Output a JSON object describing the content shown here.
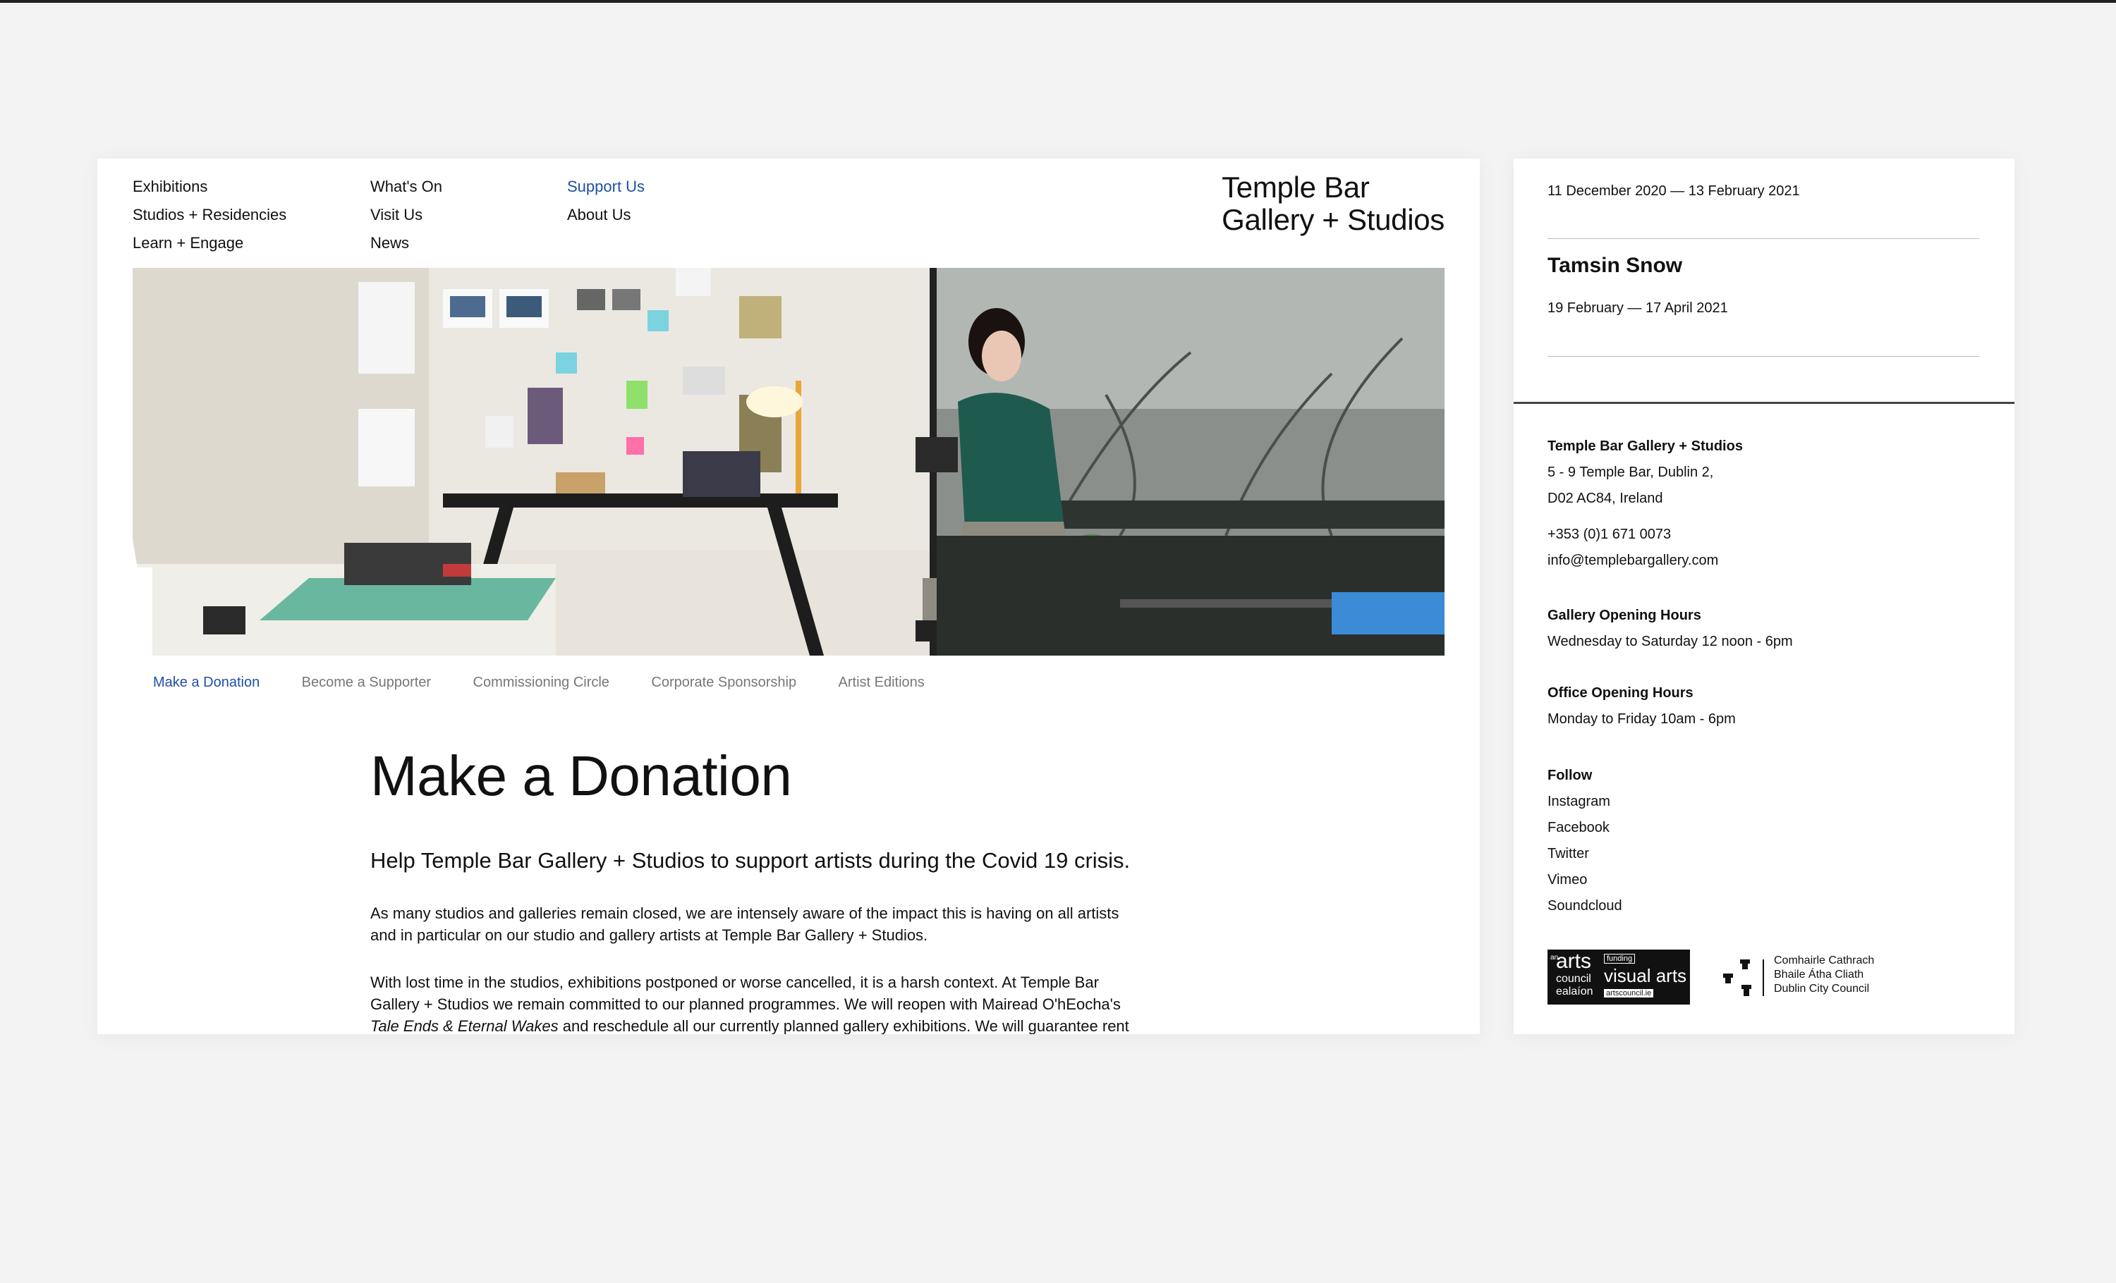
{
  "nav": {
    "col1": [
      "Exhibitions",
      "Studios + Residencies",
      "Learn + Engage"
    ],
    "col2": [
      "What's On",
      "Visit Us",
      "News"
    ],
    "col3_active": "Support Us",
    "col3": [
      "About Us"
    ]
  },
  "logo": {
    "line1": "Temple Bar",
    "line2": "Gallery + Studios"
  },
  "hero_image": {
    "alt": "Artist in studio holding a camera"
  },
  "subnav": [
    "Make a Donation",
    "Become a Supporter",
    "Commissioning Circle",
    "Corporate Sponsorship",
    "Artist Editions"
  ],
  "content": {
    "title": "Make a Donation",
    "lead": "Help Temple Bar Gallery + Studios to support artists during the Covid 19 crisis.",
    "p1": "As many studios and galleries remain closed, we are intensely aware of the impact this is having on all artists and in particular on our studio and gallery artists at Temple Bar Gallery + Studios.",
    "p2_a": "With lost time in the studios, exhibitions postponed or worse cancelled, it is a harsh context. At Temple Bar Gallery + Studios we remain committed to our planned programmes. We will reopen with Mairead O'hEocha's",
    "p2_italic": "Tale Ends & Eternal Wakes",
    "p2_b": "and reschedule all our currently planned gallery exhibitions. We will guarantee rent"
  },
  "sidebar": {
    "event1_date": "11 December 2020 — 13 February 2021",
    "event2_title": "Tamsin Snow",
    "event2_date": "19 February — 17 April 2021",
    "org_name": "Temple Bar Gallery + Studios",
    "address1": "5 - 9 Temple Bar, Dublin 2,",
    "address2": "D02 AC84, Ireland",
    "phone": "+353 (0)1 671 0073",
    "email": "info@templebargallery.com",
    "gallery_hours_head": "Gallery Opening Hours",
    "gallery_hours": "Wednesday to Saturday 12 noon - 6pm",
    "office_hours_head": "Office Opening Hours",
    "office_hours": "Monday to Friday 10am - 6pm",
    "follow_head": "Follow",
    "follow": [
      "Instagram",
      "Facebook",
      "Twitter",
      "Vimeo",
      "Soundcloud"
    ],
    "logo1": {
      "small": "an",
      "word": "arts",
      "line2": "council",
      "line3": "ealaíon",
      "funding": "funding",
      "right": "visual arts",
      "url": "artscouncil.ie"
    },
    "logo2": [
      "Comhairle Cathrach",
      "Bhaile Átha Cliath",
      "Dublin City Council"
    ]
  }
}
